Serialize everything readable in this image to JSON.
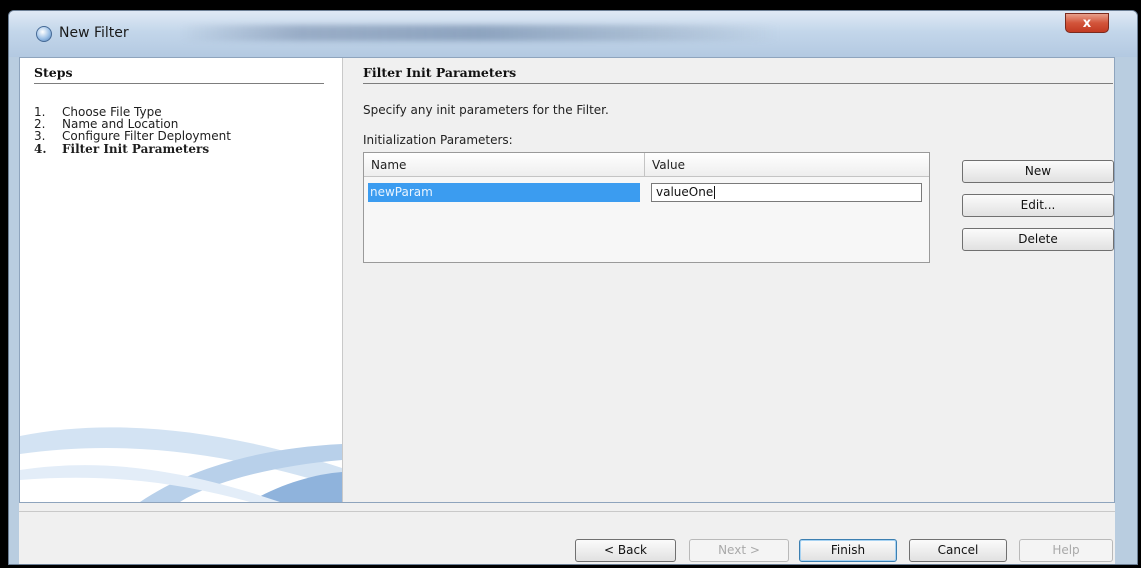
{
  "window": {
    "title": "New Filter",
    "close_label": "x"
  },
  "steps": {
    "heading": "Steps",
    "items": [
      {
        "num": "1.",
        "label": "Choose File Type"
      },
      {
        "num": "2.",
        "label": "Name and Location"
      },
      {
        "num": "3.",
        "label": "Configure Filter Deployment"
      },
      {
        "num": "4.",
        "label": "Filter Init Parameters"
      }
    ]
  },
  "panel": {
    "heading": "Filter Init Parameters",
    "description": "Specify any init parameters for the Filter.",
    "table_label": "Initialization Parameters:",
    "columns": [
      "Name",
      "Value"
    ],
    "rows": [
      {
        "name": "newParam",
        "value": "valueOne"
      }
    ],
    "buttons": {
      "new": "New",
      "edit": "Edit...",
      "delete": "Delete"
    }
  },
  "footer": {
    "back": "< Back",
    "next": "Next >",
    "finish": "Finish",
    "cancel": "Cancel",
    "help": "Help"
  }
}
